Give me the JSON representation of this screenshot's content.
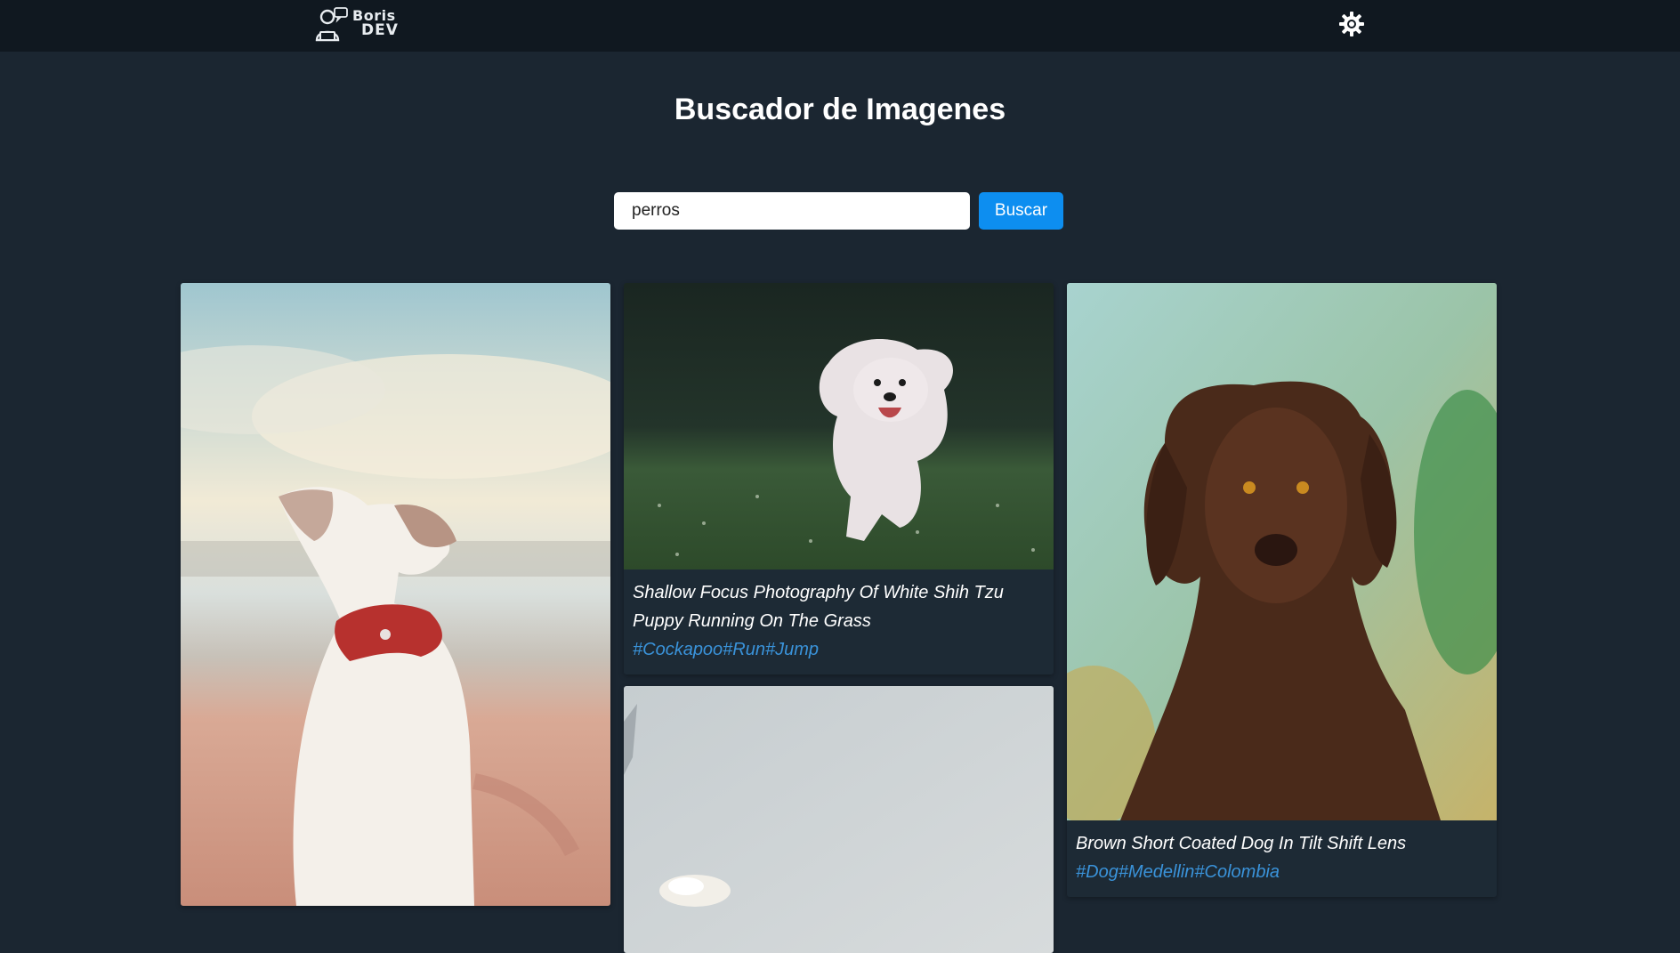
{
  "header": {
    "logo": {
      "line1": "Boris",
      "line2": "DEV"
    },
    "theme_toggle_icon": "sun-gear-icon"
  },
  "main": {
    "title": "Buscador de Imagenes",
    "search": {
      "value": "perros",
      "placeholder": "",
      "button_label": "Buscar"
    }
  },
  "results": [
    {
      "title": "",
      "tags": ""
    },
    {
      "title": "Shallow Focus Photography Of White Shih Tzu Puppy Running On The Grass",
      "tags": "#Cockapoo#Run#Jump"
    },
    {
      "title": "Brown Short Coated Dog In Tilt Shift Lens",
      "tags": "#Dog#Medellin#Colombia"
    },
    {
      "title": "",
      "tags": ""
    }
  ],
  "colors": {
    "background": "#1b2631",
    "navbar": "#101820",
    "accent": "#0d8ef0",
    "tag": "#3a93da"
  }
}
